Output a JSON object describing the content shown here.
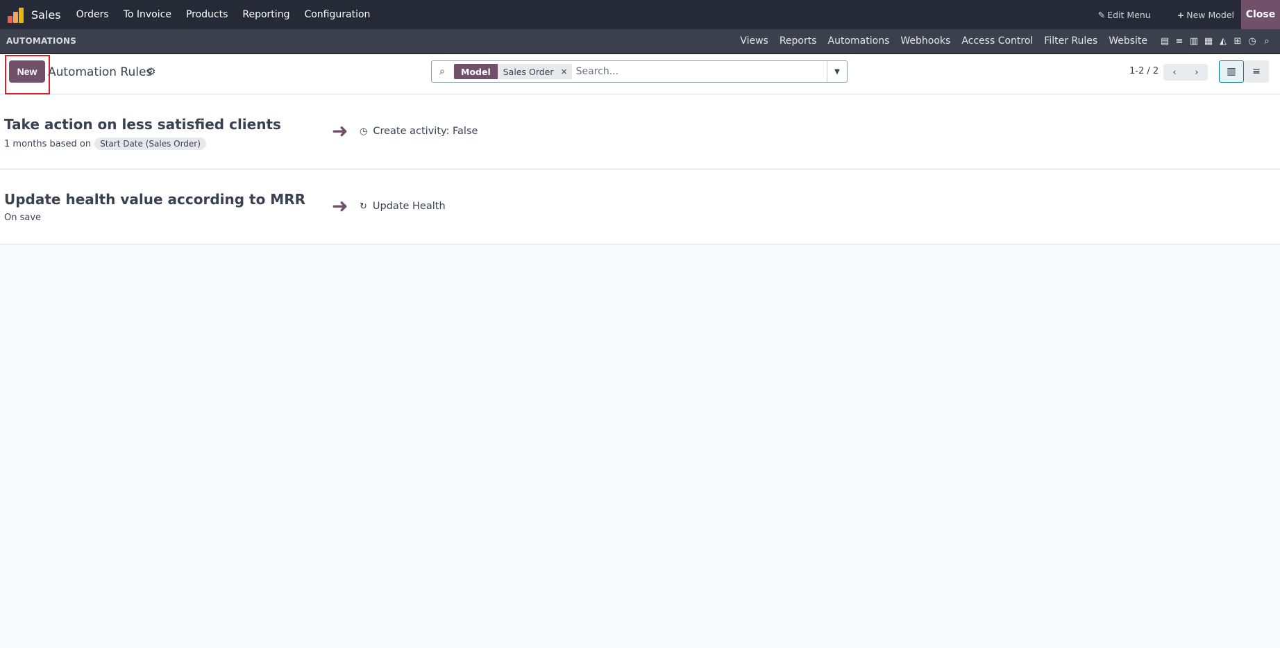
{
  "topbar": {
    "app_name": "Sales",
    "menu": [
      "Orders",
      "To Invoice",
      "Products",
      "Reporting",
      "Configuration"
    ],
    "edit_menu": "Edit Menu",
    "new_model": "New Model",
    "close": "Close",
    "logo_colors": [
      "#f06050",
      "#f4a460",
      "#e6b80f",
      "#714b67"
    ]
  },
  "studiobar": {
    "title": "AUTOMATIONS",
    "tabs": [
      "Views",
      "Reports",
      "Automations",
      "Webhooks",
      "Access Control",
      "Filter Rules",
      "Website"
    ]
  },
  "control": {
    "new_label": "New",
    "breadcrumb": "Automation Rules",
    "facet_label": "Model",
    "facet_value": "Sales Order",
    "search_placeholder": "Search...",
    "pager": "1-2 / 2"
  },
  "rules": [
    {
      "title": "Take action on less satisfied clients",
      "trigger_text": "1 months based on",
      "trigger_field": "Start Date (Sales Order)",
      "action": "Create activity: False",
      "action_icon": "clock-icon"
    },
    {
      "title": "Update health value according to MRR",
      "trigger_text": "On save",
      "action": "Update Health",
      "action_icon": "refresh-icon"
    }
  ],
  "colors": {
    "brand": "#71506a",
    "topbar": "#262a36",
    "studiobar": "#3c3f4c",
    "highlight": "#e01b24"
  }
}
